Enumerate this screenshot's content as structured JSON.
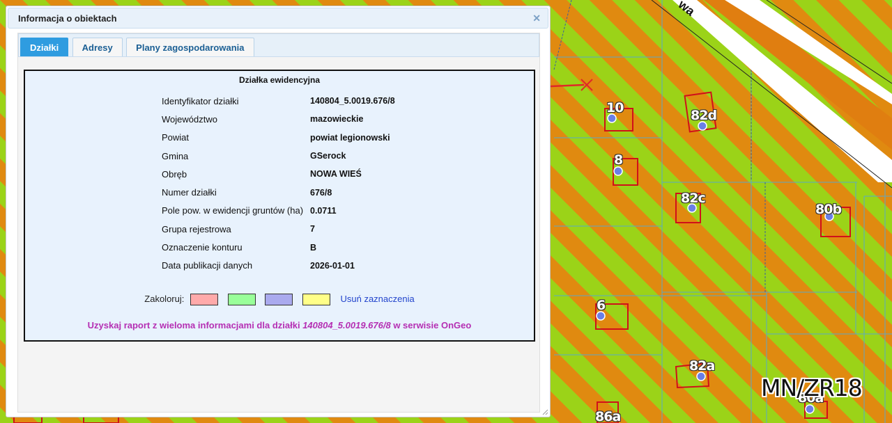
{
  "dialog": {
    "title": "Informacja o obiektach",
    "close_icon": "close-icon"
  },
  "tabs": [
    {
      "label": "Działki",
      "active": true
    },
    {
      "label": "Adresy",
      "active": false
    },
    {
      "label": "Plany zagospodarowania",
      "active": false
    }
  ],
  "parcel": {
    "heading": "Działka ewidencyjna",
    "rows": [
      {
        "label": "Identyfikator działki",
        "value": "140804_5.0019.676/8"
      },
      {
        "label": "Województwo",
        "value": "mazowieckie"
      },
      {
        "label": "Powiat",
        "value": "powiat legionowski"
      },
      {
        "label": "Gmina",
        "value": "GSerock"
      },
      {
        "label": "Obręb",
        "value": "NOWA WIEŚ"
      },
      {
        "label": "Numer działki",
        "value": "676/8"
      },
      {
        "label": "Pole pow. w ewidencji gruntów (ha)",
        "value": "0.0711"
      },
      {
        "label": "Grupa rejestrowa",
        "value": "7"
      },
      {
        "label": "Oznaczenie konturu",
        "value": "B"
      },
      {
        "label": "Data publikacji danych",
        "value": "2026-01-01"
      }
    ]
  },
  "colorize": {
    "label": "Zakoloruj:",
    "swatches": [
      "#ffaaaa",
      "#99ff99",
      "#aaaaee",
      "#ffff88"
    ],
    "clear_label": "Usuń zaznaczenia"
  },
  "report": {
    "prefix": "Uzyskaj raport z wieloma informacjami dla działki",
    "parcel_id": "140804_5.0019.676/8",
    "suffix": "w serwisie OnGeo"
  },
  "map": {
    "road_label": "wa",
    "zone_label": "MN/ZR18",
    "building_labels": [
      "10",
      "82d",
      "8",
      "82c",
      "80b",
      "6",
      "82a",
      "80a",
      "86a"
    ],
    "colors": {
      "zone_orange": "#e08a10",
      "zone_green": "#9bd318",
      "building_outline": "#d0101a",
      "address_point": "#6a7fe6",
      "parcel_line": "#5aa8c8",
      "marker": "#e02828"
    }
  }
}
